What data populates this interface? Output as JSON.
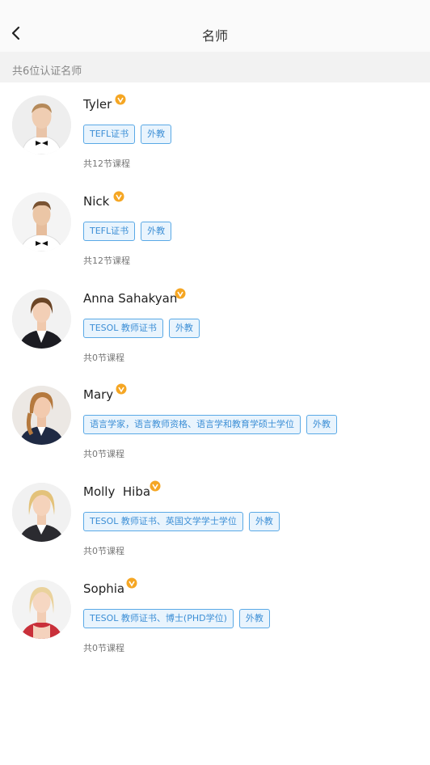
{
  "header": {
    "title": "名师"
  },
  "subbar": {
    "text": "共6位认证名师"
  },
  "colors": {
    "tag_border": "#5aa9e6",
    "tag_bg": "#e9f4fd",
    "tag_text": "#3d8fd6",
    "badge": "#f5a623"
  },
  "teachers": [
    {
      "name": "Tyler",
      "tags": [
        "TEFL证书",
        "外教"
      ],
      "courses": "共12节课程"
    },
    {
      "name": "Nick",
      "tags": [
        "TEFL证书",
        "外教"
      ],
      "courses": "共12节课程"
    },
    {
      "name": "Anna Sahakyan",
      "tags": [
        "TESOL 教师证书",
        "外教"
      ],
      "courses": "共0节课程"
    },
    {
      "name": "Mary",
      "tags": [
        "语言学家，语言教师资格、语言学和教育学硕士学位",
        "外教"
      ],
      "courses": "共0节课程"
    },
    {
      "name": "Molly  Hiba",
      "tags": [
        "TESOL 教师证书、英国文学学士学位",
        "外教"
      ],
      "courses": "共0节课程"
    },
    {
      "name": "Sophia",
      "tags": [
        "TESOL 教师证书、博士(PHD学位)",
        "外教"
      ],
      "courses": "共0节课程"
    }
  ]
}
